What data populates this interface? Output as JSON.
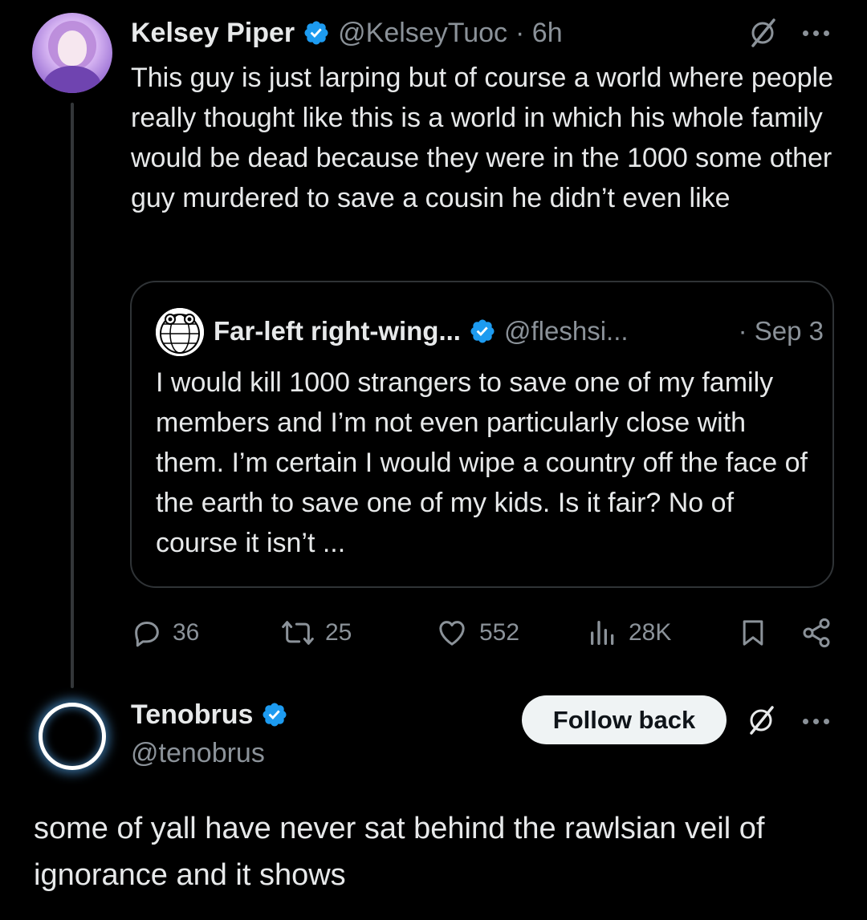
{
  "tweet": {
    "author_name": "Kelsey Piper",
    "handle": "@KelseyTuoc",
    "time": "· 6h",
    "text": "This guy is just larping but of course a world where people really thought like this is a world in which his whole family would be dead because they were in the 1000 some other guy murdered to save a cousin he didn’t even like",
    "quote": {
      "author_name": "Far-left right-wing...",
      "handle": "@fleshsi...",
      "date": "· Sep 3",
      "text": "I would kill 1000 strangers to save one of my family members and I’m not even particularly close with them. I’m certain I would wipe a country off the face of the earth to save one of my kids. Is it fair? No of course it isn’t ..."
    },
    "actions": {
      "replies": "36",
      "reposts": "25",
      "likes": "552",
      "views": "28K"
    }
  },
  "reply": {
    "author_name": "Tenobrus",
    "handle": "@tenobrus",
    "follow_label": "Follow back",
    "text": "some of yall have never sat behind the rawlsian veil of ignorance and it shows"
  },
  "colors": {
    "background": "#000000",
    "text": "#e7e9ea",
    "muted": "#8b9299",
    "verified": "#1d9bf0",
    "border": "#2f3336"
  },
  "icons": [
    "verified-badge-icon",
    "grok-icon",
    "more-icon",
    "reply-icon",
    "repost-icon",
    "like-icon",
    "views-icon",
    "bookmark-icon",
    "share-icon"
  ]
}
